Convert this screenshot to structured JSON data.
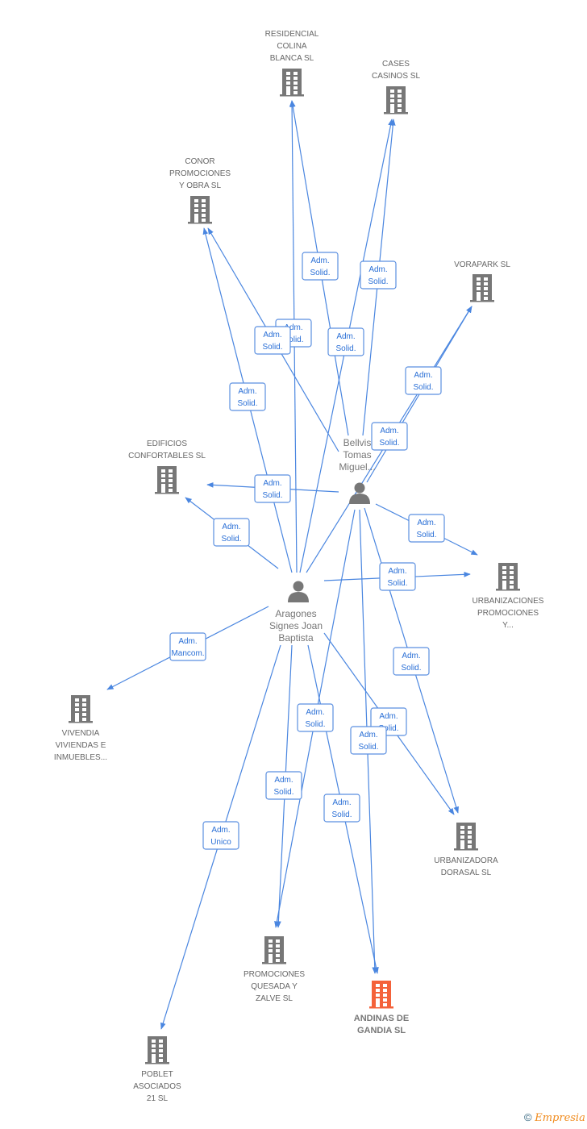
{
  "colors": {
    "edge": "#4a86e0",
    "company": "#777777",
    "highlight": "#f4623a",
    "person": "#777777"
  },
  "companies": [
    {
      "id": "residencial",
      "lines": [
        "RESIDENCIAL",
        "COLINA",
        "BLANCA SL"
      ]
    },
    {
      "id": "cases",
      "lines": [
        "CASES",
        "CASINOS SL"
      ]
    },
    {
      "id": "conor",
      "lines": [
        "CONOR",
        "PROMOCIONES",
        "Y OBRA SL"
      ]
    },
    {
      "id": "vorapark",
      "lines": [
        "VORAPARK SL"
      ]
    },
    {
      "id": "edificios",
      "lines": [
        "EDIFICIOS",
        "CONFORTABLES SL"
      ]
    },
    {
      "id": "urbanizaciones",
      "lines": [
        "URBANIZACIONES",
        "PROMOCIONES",
        "Y..."
      ]
    },
    {
      "id": "vivendia",
      "lines": [
        "VIVENDIA",
        "VIVIENDAS E",
        "INMUEBLES..."
      ]
    },
    {
      "id": "urbanizadora",
      "lines": [
        "URBANIZADORA",
        "DORASAL SL"
      ]
    },
    {
      "id": "quesada",
      "lines": [
        "PROMOCIONES",
        "QUESADA Y",
        "ZALVE SL"
      ]
    },
    {
      "id": "andinas",
      "lines": [
        "ANDINAS DE",
        "GANDIA SL"
      ],
      "highlight": true
    },
    {
      "id": "poblet",
      "lines": [
        "POBLET",
        "ASOCIADOS",
        "21 SL"
      ]
    }
  ],
  "persons": [
    {
      "id": "bellvis",
      "lines": [
        "Bellvis",
        "Tomas",
        "Miguel..."
      ]
    },
    {
      "id": "aragones",
      "lines": [
        "Aragones",
        "Signes Joan",
        "Baptista"
      ]
    }
  ],
  "edges": [
    {
      "from": "bellvis",
      "to": "residencial",
      "role": [
        "Adm.",
        "Solid."
      ]
    },
    {
      "from": "aragones",
      "to": "residencial",
      "role": [
        "Adm.",
        "Solid."
      ]
    },
    {
      "from": "aragones",
      "to": "cases",
      "role": [
        "Adm.",
        "Solid."
      ]
    },
    {
      "from": "bellvis",
      "to": "cases",
      "role": [
        "Adm.",
        "Solid."
      ]
    },
    {
      "from": "bellvis",
      "to": "conor",
      "role": [
        "Adm.",
        "Solid."
      ]
    },
    {
      "from": "aragones",
      "to": "conor",
      "role": [
        "Adm.",
        "Solid."
      ]
    },
    {
      "from": "bellvis",
      "to": "vorapark",
      "role": [
        "Adm.",
        "Solid."
      ]
    },
    {
      "from": "aragones",
      "to": "vorapark",
      "role": [
        "Adm.",
        "Solid."
      ]
    },
    {
      "from": "bellvis",
      "to": "edificios",
      "role": [
        "Adm.",
        "Solid."
      ]
    },
    {
      "from": "aragones",
      "to": "edificios",
      "role": [
        "Adm.",
        "Solid."
      ]
    },
    {
      "from": "bellvis",
      "to": "urbanizaciones",
      "role": [
        "Adm.",
        "Solid."
      ]
    },
    {
      "from": "aragones",
      "to": "urbanizaciones",
      "role": [
        "Adm.",
        "Solid."
      ]
    },
    {
      "from": "aragones",
      "to": "vivendia",
      "role": [
        "Adm.",
        "Mancom."
      ]
    },
    {
      "from": "bellvis",
      "to": "urbanizadora",
      "role": [
        "Adm.",
        "Solid."
      ]
    },
    {
      "from": "aragones",
      "to": "urbanizadora",
      "role": [
        "Adm.",
        "Solid."
      ]
    },
    {
      "from": "bellvis",
      "to": "quesada",
      "role": [
        "Adm.",
        "Solid."
      ]
    },
    {
      "from": "aragones",
      "to": "quesada",
      "role": [
        "Adm.",
        "Solid."
      ]
    },
    {
      "from": "bellvis",
      "to": "andinas",
      "role": [
        "Adm.",
        "Solid."
      ]
    },
    {
      "from": "aragones",
      "to": "andinas",
      "role": [
        "Adm.",
        "Solid."
      ]
    },
    {
      "from": "aragones",
      "to": "poblet",
      "role": [
        "Adm.",
        "Unico"
      ]
    }
  ],
  "footer": {
    "copyright": "©",
    "brand": "Empresia"
  }
}
